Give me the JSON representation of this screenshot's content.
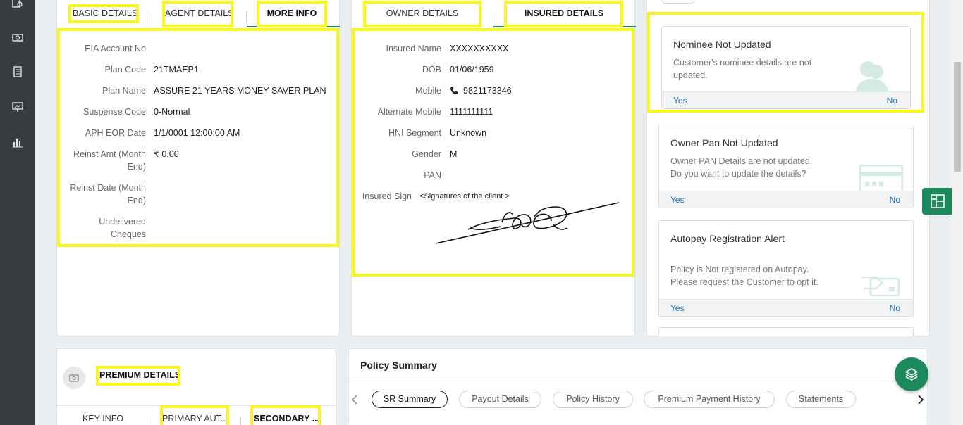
{
  "tabs_left": [
    "BASIC DETAILS",
    "AGENT DETAILS",
    "MORE INFO"
  ],
  "tabs_mid": [
    "OWNER DETAILS",
    "INSURED DETAILS"
  ],
  "basic": {
    "labels": [
      "EIA Account No",
      "Plan Code",
      "Plan Name",
      "Suspense Code",
      "APH EOR Date",
      "Reinst Amt (Month",
      "End)",
      "Reinst Date (Month",
      "End)",
      "Undelivered",
      "Cheques"
    ],
    "values": [
      "",
      "21TMAEP1",
      "ASSURE 21 YEARS MONEY SAVER PLAN",
      "0-Normal",
      "1/1/0001 12:00:00 AM",
      "₹ 0.00",
      "",
      ""
    ]
  },
  "insured": {
    "labels": [
      "Insured Name",
      "DOB",
      "Mobile",
      "Alternate Mobile",
      "HNI Segment",
      "Gender",
      "PAN",
      "Insured Sign"
    ],
    "values": [
      "XXXXXXXXXX",
      "01/06/1959",
      "9821173346",
      "1111111111",
      "Unknown",
      "M",
      "",
      ""
    ],
    "sign_caption": "<Signatures of the client >"
  },
  "alerts": [
    {
      "title": "Nominee Not Updated",
      "desc1": "Customer's nominee details are not",
      "desc2": "updated.",
      "yes": "Yes",
      "no": "No",
      "icon": "person-icon"
    },
    {
      "title": "Owner Pan Not Updated",
      "desc1": "Owner PAN Details are not updated.",
      "desc2": "Do you want to update the details?",
      "yes": "Yes",
      "no": "No",
      "icon": "card-icon"
    },
    {
      "title": "Autopay Registration Alert",
      "desc1": "Policy is Not registered on Autopay.",
      "desc2": "Please request the Customer to opt it.",
      "yes": "Yes",
      "no": "No",
      "icon": "payment-card-icon"
    }
  ],
  "premium": {
    "title": "PREMIUM DETAILS",
    "tabs": [
      "KEY INFO",
      "PRIMARY AUT...",
      "SECONDARY ..."
    ]
  },
  "policy_summary": {
    "title": "Policy Summary",
    "pills": [
      "SR Summary",
      "Payout Details",
      "Policy History",
      "Premium Payment History",
      "Statements"
    ]
  },
  "colors": {
    "accent": "#1d8a5e",
    "highlight": "#f7f71e",
    "sidebar": "#3a3d40",
    "link": "#1a6fb5"
  }
}
